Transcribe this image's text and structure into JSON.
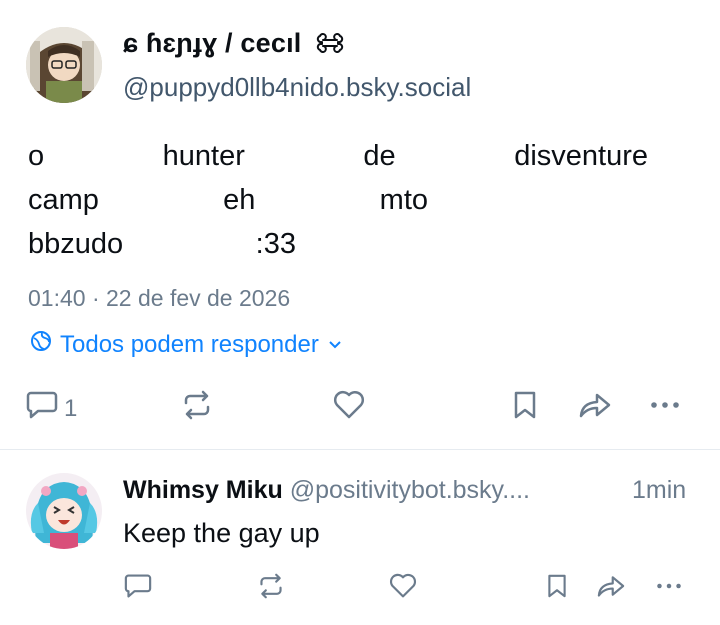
{
  "post": {
    "author": {
      "display_name": "ɕ ɦɛɲɟɣ / cecıl",
      "handle": "@puppyd0llb4nido.bsky.social"
    },
    "text_lines": [
      [
        "o",
        "hunter",
        "de",
        "disventure"
      ],
      [
        "camp",
        "eh",
        "mto"
      ],
      [
        "bbzudo",
        ":33"
      ]
    ],
    "timestamp": "01:40 · 22 de fev de 2026",
    "reply_setting": "Todos podem responder",
    "actions": {
      "reply_count": "1"
    }
  },
  "reply": {
    "display_name": "Whimsy Miku",
    "handle": "@positivitybot.bsky....",
    "time": "1min",
    "text": "Keep the gay up"
  },
  "colors": {
    "accent": "#1083fe",
    "muted": "#6b7b8c",
    "handle": "#42576c",
    "divider": "#e6ebf0"
  },
  "icons": {
    "reply": "speech-bubble-icon",
    "repost": "repost-arrows-icon",
    "like": "heart-icon",
    "bookmark": "bookmark-icon",
    "share": "share-arrow-icon",
    "more": "ellipsis-icon",
    "reply_setting": "globe-icon"
  }
}
